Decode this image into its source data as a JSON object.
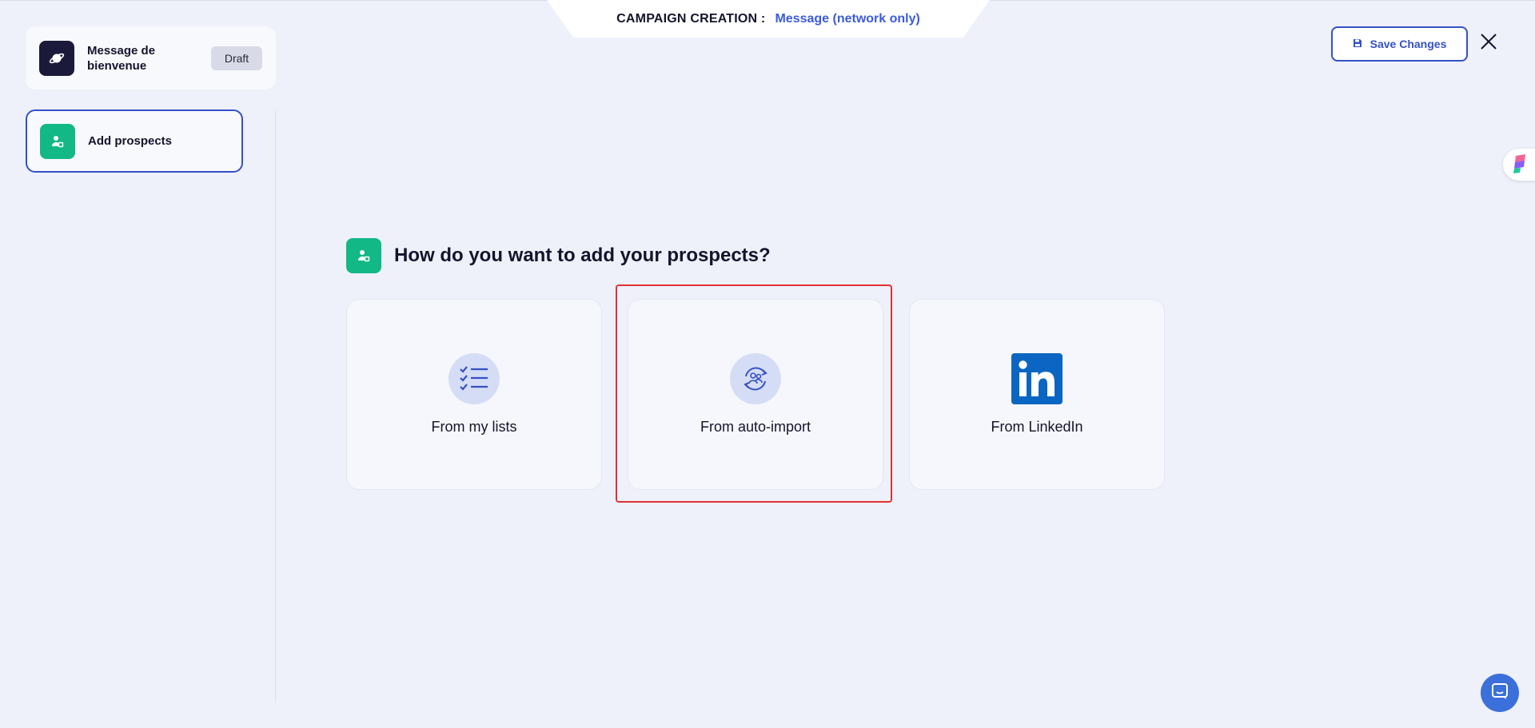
{
  "header": {
    "label": "CAMPAIGN CREATION :",
    "value": "Message (network only)"
  },
  "toolbar": {
    "save_label": "Save Changes"
  },
  "sidebar": {
    "campaign": {
      "name": "Message de bienvenue",
      "status": "Draft"
    },
    "steps": [
      {
        "label": "Add prospects"
      }
    ]
  },
  "main": {
    "question": "How do you want to add your prospects?",
    "options": [
      {
        "label": "From my lists",
        "icon": "checklist-icon"
      },
      {
        "label": "From auto-import",
        "icon": "sync-users-icon"
      },
      {
        "label": "From LinkedIn",
        "icon": "linkedin-icon"
      }
    ]
  },
  "colors": {
    "accent": "#3451c6",
    "green": "#12b886",
    "highlight": "#e03131",
    "linkedin": "#0a66c2",
    "background": "#eef0fa"
  }
}
